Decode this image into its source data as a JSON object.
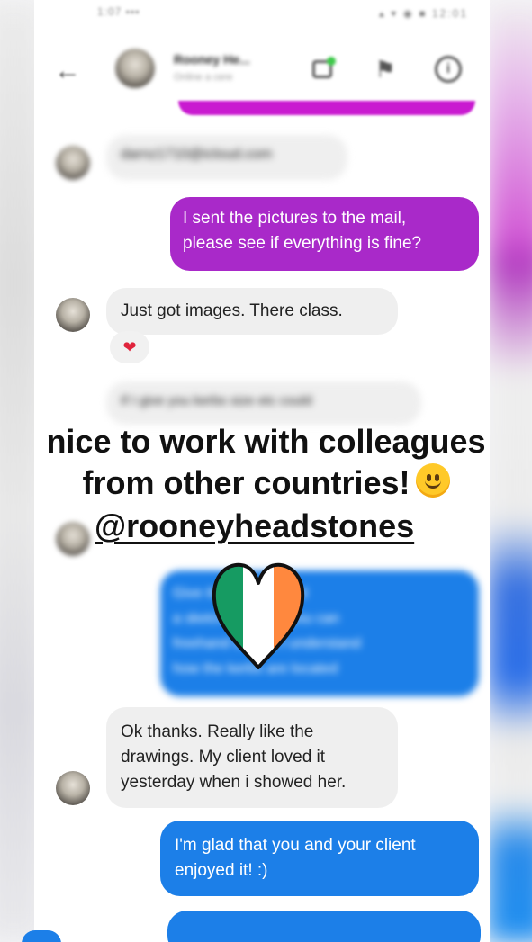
{
  "status_bar": {
    "left_text": "1:07 ▪▪▪",
    "right_text": "▴ ▾ ◉ ■ 12:01"
  },
  "header": {
    "contact_name": "Rooney He...",
    "contact_subtitle": "Online a cere",
    "icons": [
      "back-arrow-icon",
      "video-call-icon",
      "flag-icon",
      "info-icon"
    ]
  },
  "messages": [
    {
      "side": "in",
      "text": "darnz1710@icloud.com",
      "blurred": true
    },
    {
      "side": "out",
      "color": "purple",
      "lines": [
        "I sent the pictures to the mail,",
        "please see if everything is fine?"
      ]
    },
    {
      "side": "in",
      "text": "Just got images. There class.",
      "reaction": "❤"
    },
    {
      "side": "in",
      "text": "If I give you kerbs size etc could",
      "blurred": true
    },
    {
      "side": "out",
      "color": "blue",
      "blurred": true,
      "lines": [
        "Give the borders and",
        "a sketch drawing, you can",
        "freehand so that I understand",
        "how the kerbs are located"
      ]
    },
    {
      "side": "in",
      "lines": [
        "Ok thanks. Really like the",
        "drawings. My client loved it",
        "yesterday when i showed her."
      ]
    },
    {
      "side": "out",
      "color": "blue",
      "lines": [
        "I'm glad that you and your client",
        "enjoyed it! :)"
      ]
    }
  ],
  "overlay": {
    "line1": "nice to work with colleagues",
    "line2": "from other countries!",
    "mention": "@rooneyheadstones",
    "emoji": "smiling-face-icon",
    "sticker": "irish-flag-heart-icon"
  },
  "colors": {
    "purple_bubble": "#a929c9",
    "blue_bubble": "#1c7fe8",
    "incoming_bubble": "#efefef",
    "heart_green": "#169b62",
    "heart_orange": "#ff883e"
  }
}
